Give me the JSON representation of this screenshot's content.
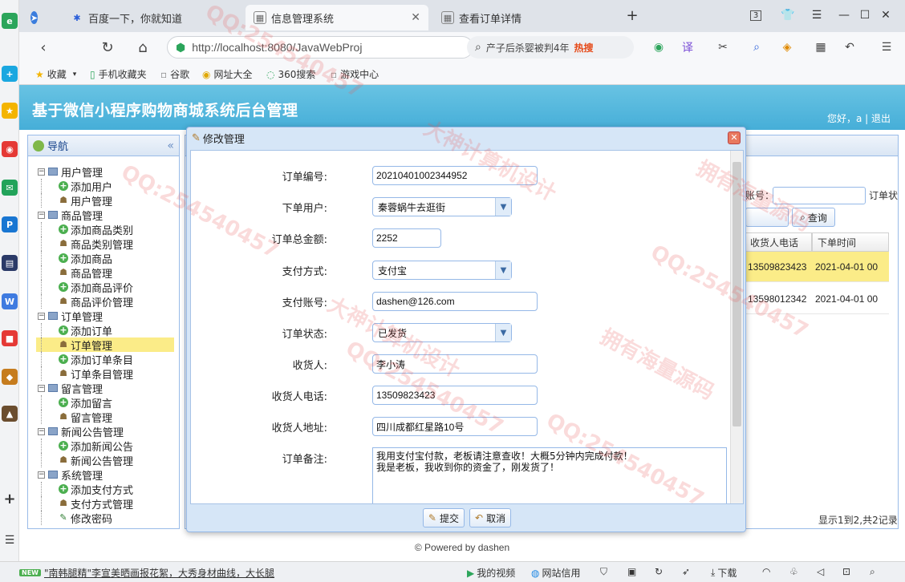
{
  "browser": {
    "tabs": [
      {
        "label": "百度一下，你就知道"
      },
      {
        "label": "信息管理系统"
      },
      {
        "label": "查看订单详情"
      }
    ],
    "tab_count": "3",
    "url": "http://localhost:8080/JavaWebProj",
    "search_text": "产子后杀婴被判4年",
    "search_hot": "热搜",
    "bookmarks": [
      "收藏",
      "手机收藏夹",
      "谷歌",
      "网址大全",
      "360搜索",
      "游戏中心"
    ]
  },
  "app": {
    "title": "基于微信小程序购物商城系统后台管理",
    "greeting": "您好，a | 退出"
  },
  "nav": {
    "title": "导航",
    "items": [
      {
        "label": "用户管理",
        "level": 0
      },
      {
        "label": "添加用户",
        "level": 1,
        "icon": "add"
      },
      {
        "label": "用户管理",
        "level": 1,
        "icon": "user"
      },
      {
        "label": "商品管理",
        "level": 0
      },
      {
        "label": "添加商品类别",
        "level": 1,
        "icon": "add"
      },
      {
        "label": "商品类别管理",
        "level": 1,
        "icon": "user"
      },
      {
        "label": "添加商品",
        "level": 1,
        "icon": "add"
      },
      {
        "label": "商品管理",
        "level": 1,
        "icon": "user"
      },
      {
        "label": "添加商品评价",
        "level": 1,
        "icon": "add"
      },
      {
        "label": "商品评价管理",
        "level": 1,
        "icon": "user"
      },
      {
        "label": "订单管理",
        "level": 0
      },
      {
        "label": "添加订单",
        "level": 1,
        "icon": "add"
      },
      {
        "label": "订单管理",
        "level": 1,
        "icon": "user",
        "selected": true
      },
      {
        "label": "添加订单条目",
        "level": 1,
        "icon": "add"
      },
      {
        "label": "订单条目管理",
        "level": 1,
        "icon": "user"
      },
      {
        "label": "留言管理",
        "level": 0
      },
      {
        "label": "添加留言",
        "level": 1,
        "icon": "add"
      },
      {
        "label": "留言管理",
        "level": 1,
        "icon": "user"
      },
      {
        "label": "新闻公告管理",
        "level": 0
      },
      {
        "label": "添加新闻公告",
        "level": 1,
        "icon": "add"
      },
      {
        "label": "新闻公告管理",
        "level": 1,
        "icon": "user"
      },
      {
        "label": "系统管理",
        "level": 0
      },
      {
        "label": "添加支付方式",
        "level": 1,
        "icon": "add"
      },
      {
        "label": "支付方式管理",
        "level": 1,
        "icon": "user"
      },
      {
        "label": "修改密码",
        "level": 1,
        "icon": "pen"
      }
    ]
  },
  "grid": {
    "filter_label": "账号：",
    "filter_label2": "订单状",
    "query_button": "查询",
    "columns": [
      "收货人电话",
      "下单时间"
    ],
    "rows": [
      [
        "13509823423",
        "2021-04-01 00"
      ],
      [
        "13598012342",
        "2021-04-01 00"
      ]
    ],
    "paging": "显示1到2,共2记录"
  },
  "dialog": {
    "title": "修改管理",
    "fields": {
      "order_no": {
        "label": "订单编号:",
        "value": "20210401002344952"
      },
      "user": {
        "label": "下单用户:",
        "value": "秦蓉蜗牛去逛街"
      },
      "total": {
        "label": "订单总金额:",
        "value": "2252"
      },
      "pay_method": {
        "label": "支付方式:",
        "value": "支付宝"
      },
      "pay_account": {
        "label": "支付账号:",
        "value": "dashen@126.com"
      },
      "status": {
        "label": "订单状态:",
        "value": "已发货"
      },
      "receiver": {
        "label": "收货人:",
        "value": "李小涛"
      },
      "phone": {
        "label": "收货人电话:",
        "value": "13509823423"
      },
      "address": {
        "label": "收货人地址:",
        "value": "四川成都红星路10号"
      },
      "memo": {
        "label": "订单备注:",
        "value": "我用支付宝付款，老板请注意查收！大概5分钟内完成付款！\n我是老板，我收到你的资金了，刚发货了！"
      }
    },
    "submit": "提交",
    "cancel": "取消"
  },
  "footer": {
    "powered": "© Powered by dashen"
  },
  "statusbar": {
    "news_tag": "NEW",
    "news": "\"南韩腿精\"李宣美晒画报花絮，大秀身材曲线，大长腿",
    "my_video": "我的视频",
    "credit": "网站信用",
    "download": "下载"
  },
  "watermarks": [
    "QQ:254540457",
    "大神计算机设计",
    "拥有海量源码"
  ]
}
